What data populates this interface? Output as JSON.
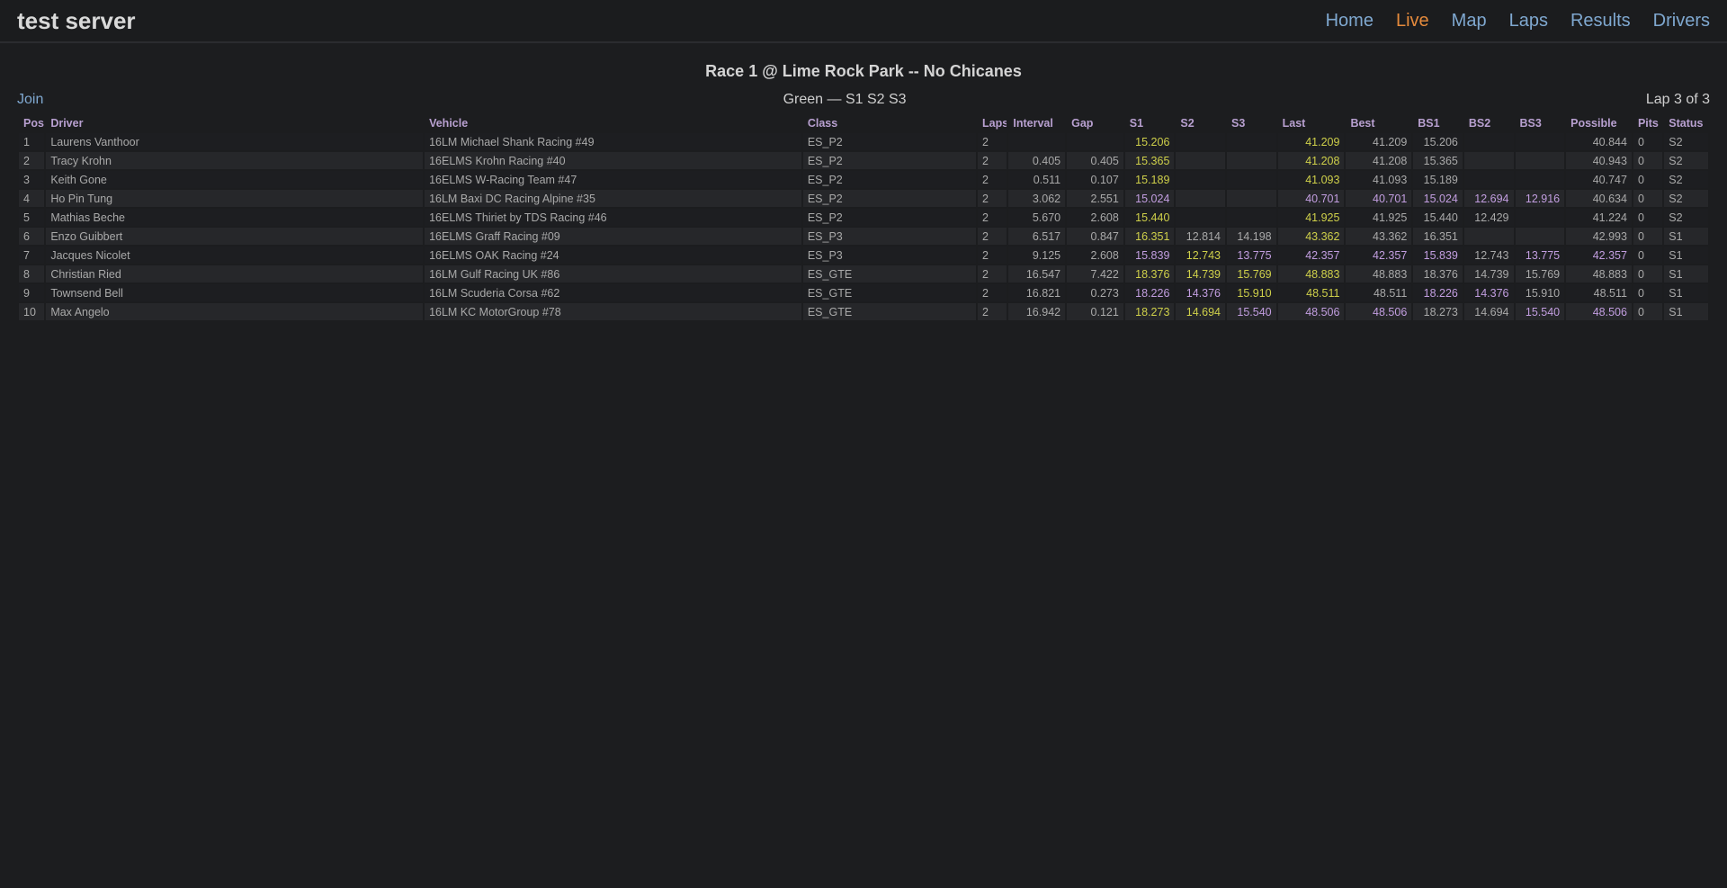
{
  "app": {
    "title": "test server"
  },
  "nav": [
    "Home",
    "Live",
    "Map",
    "Laps",
    "Results",
    "Drivers"
  ],
  "nav_active": "Live",
  "race": {
    "title": "Race 1 @ Lime Rock Park -- No Chicanes",
    "join_label": "Join",
    "flag_status": "Green — S1 S2 S3",
    "lap_status": "Lap 3 of 3"
  },
  "colors": {
    "purple": "#c29ee0",
    "yellow": "#cfd04a",
    "link": "#7fa8d0",
    "active": "#e58a3c"
  },
  "table": {
    "columns": [
      "Pos",
      "Driver",
      "Vehicle",
      "Class",
      "Laps",
      "Interval",
      "Gap",
      "S1",
      "S2",
      "S3",
      "Last",
      "Best",
      "BS1",
      "BS2",
      "BS3",
      "Possible",
      "Pits",
      "Status"
    ],
    "rows": [
      {
        "pos": "1",
        "driver": "Laurens Vanthoor",
        "vehicle": "16LM Michael Shank Racing #49",
        "class": "ES_P2",
        "laps": "2",
        "interval": "",
        "gap": "",
        "s1": "15.206",
        "s2": "",
        "s3": "",
        "last": "41.209",
        "best": "41.209",
        "bs1": "15.206",
        "bs2": "",
        "bs3": "",
        "possible": "40.844",
        "pits": "0",
        "status": "S2",
        "hl": {
          "s1": "yellow",
          "last": "yellow"
        }
      },
      {
        "pos": "2",
        "driver": "Tracy Krohn",
        "vehicle": "16ELMS Krohn Racing #40",
        "class": "ES_P2",
        "laps": "2",
        "interval": "0.405",
        "gap": "0.405",
        "s1": "15.365",
        "s2": "",
        "s3": "",
        "last": "41.208",
        "best": "41.208",
        "bs1": "15.365",
        "bs2": "",
        "bs3": "",
        "possible": "40.943",
        "pits": "0",
        "status": "S2",
        "hl": {
          "s1": "yellow",
          "last": "yellow"
        }
      },
      {
        "pos": "3",
        "driver": "Keith Gone",
        "vehicle": "16ELMS W-Racing Team #47",
        "class": "ES_P2",
        "laps": "2",
        "interval": "0.511",
        "gap": "0.107",
        "s1": "15.189",
        "s2": "",
        "s3": "",
        "last": "41.093",
        "best": "41.093",
        "bs1": "15.189",
        "bs2": "",
        "bs3": "",
        "possible": "40.747",
        "pits": "0",
        "status": "S2",
        "hl": {
          "s1": "yellow",
          "last": "yellow"
        }
      },
      {
        "pos": "4",
        "driver": "Ho Pin Tung",
        "vehicle": "16LM Baxi DC Racing Alpine #35",
        "class": "ES_P2",
        "laps": "2",
        "interval": "3.062",
        "gap": "2.551",
        "s1": "15.024",
        "s2": "",
        "s3": "",
        "last": "40.701",
        "best": "40.701",
        "bs1": "15.024",
        "bs2": "12.694",
        "bs3": "12.916",
        "possible": "40.634",
        "pits": "0",
        "status": "S2",
        "hl": {
          "s1": "purple",
          "last": "purple",
          "best": "purple",
          "bs1": "purple",
          "bs2": "purple",
          "bs3": "purple"
        }
      },
      {
        "pos": "5",
        "driver": "Mathias Beche",
        "vehicle": "16ELMS Thiriet by TDS Racing #46",
        "class": "ES_P2",
        "laps": "2",
        "interval": "5.670",
        "gap": "2.608",
        "s1": "15.440",
        "s2": "",
        "s3": "",
        "last": "41.925",
        "best": "41.925",
        "bs1": "15.440",
        "bs2": "12.429",
        "bs3": "",
        "possible": "41.224",
        "pits": "0",
        "status": "S2",
        "hl": {
          "s1": "yellow",
          "last": "yellow"
        }
      },
      {
        "pos": "6",
        "driver": "Enzo Guibbert",
        "vehicle": "16ELMS Graff Racing #09",
        "class": "ES_P3",
        "laps": "2",
        "interval": "6.517",
        "gap": "0.847",
        "s1": "16.351",
        "s2": "12.814",
        "s3": "14.198",
        "last": "43.362",
        "best": "43.362",
        "bs1": "16.351",
        "bs2": "",
        "bs3": "",
        "possible": "42.993",
        "pits": "0",
        "status": "S1",
        "hl": {
          "s1": "yellow",
          "last": "yellow"
        }
      },
      {
        "pos": "7",
        "driver": "Jacques Nicolet",
        "vehicle": "16ELMS OAK Racing #24",
        "class": "ES_P3",
        "laps": "2",
        "interval": "9.125",
        "gap": "2.608",
        "s1": "15.839",
        "s2": "12.743",
        "s3": "13.775",
        "last": "42.357",
        "best": "42.357",
        "bs1": "15.839",
        "bs2": "12.743",
        "bs3": "13.775",
        "possible": "42.357",
        "pits": "0",
        "status": "S1",
        "hl": {
          "s1": "purple",
          "s2": "yellow",
          "s3": "purple",
          "last": "purple",
          "best": "purple",
          "bs1": "purple",
          "bs3": "purple",
          "possible": "purple"
        }
      },
      {
        "pos": "8",
        "driver": "Christian Ried",
        "vehicle": "16LM Gulf Racing UK #86",
        "class": "ES_GTE",
        "laps": "2",
        "interval": "16.547",
        "gap": "7.422",
        "s1": "18.376",
        "s2": "14.739",
        "s3": "15.769",
        "last": "48.883",
        "best": "48.883",
        "bs1": "18.376",
        "bs2": "14.739",
        "bs3": "15.769",
        "possible": "48.883",
        "pits": "0",
        "status": "S1",
        "hl": {
          "s1": "yellow",
          "s2": "yellow",
          "s3": "yellow",
          "last": "yellow"
        }
      },
      {
        "pos": "9",
        "driver": "Townsend Bell",
        "vehicle": "16LM Scuderia Corsa #62",
        "class": "ES_GTE",
        "laps": "2",
        "interval": "16.821",
        "gap": "0.273",
        "s1": "18.226",
        "s2": "14.376",
        "s3": "15.910",
        "last": "48.511",
        "best": "48.511",
        "bs1": "18.226",
        "bs2": "14.376",
        "bs3": "15.910",
        "possible": "48.511",
        "pits": "0",
        "status": "S1",
        "hl": {
          "s1": "purple",
          "s2": "purple",
          "s3": "yellow",
          "last": "yellow",
          "bs1": "purple",
          "bs2": "purple"
        }
      },
      {
        "pos": "10",
        "driver": "Max Angelo",
        "vehicle": "16LM KC MotorGroup #78",
        "class": "ES_GTE",
        "laps": "2",
        "interval": "16.942",
        "gap": "0.121",
        "s1": "18.273",
        "s2": "14.694",
        "s3": "15.540",
        "last": "48.506",
        "best": "48.506",
        "bs1": "18.273",
        "bs2": "14.694",
        "bs3": "15.540",
        "possible": "48.506",
        "pits": "0",
        "status": "S1",
        "hl": {
          "s1": "yellow",
          "s2": "yellow",
          "s3": "purple",
          "last": "purple",
          "best": "purple",
          "bs3": "purple",
          "possible": "purple"
        }
      }
    ]
  }
}
